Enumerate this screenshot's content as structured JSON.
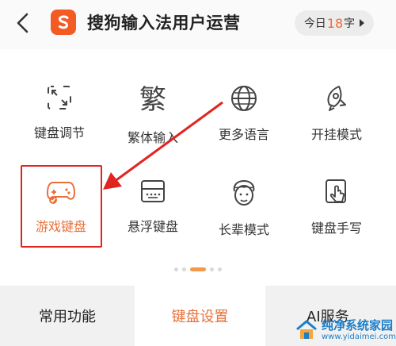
{
  "header": {
    "title": "搜狗输入法用户运营",
    "today_prefix": "今日",
    "today_count": "18",
    "today_suffix": "字",
    "accent": "#f35b24"
  },
  "features": [
    {
      "label": "键盘调节",
      "icon": "resize-icon"
    },
    {
      "label": "繁体输入",
      "icon": "traditional-char-icon",
      "glyph": "繁"
    },
    {
      "label": "更多语言",
      "icon": "globe-icon"
    },
    {
      "label": "开挂模式",
      "icon": "rocket-icon"
    },
    {
      "label": "游戏键盘",
      "icon": "gamepad-icon"
    },
    {
      "label": "悬浮键盘",
      "icon": "floating-keyboard-icon"
    },
    {
      "label": "长辈模式",
      "icon": "elder-face-icon"
    },
    {
      "label": "键盘手写",
      "icon": "handwriting-icon"
    }
  ],
  "pager": {
    "pages": 5,
    "active": 2
  },
  "tabs": [
    {
      "label": "常用功能",
      "active": false
    },
    {
      "label": "键盘设置",
      "active": true
    },
    {
      "label": "AI服务",
      "active": false
    }
  ],
  "watermark": {
    "name": "纯净系统家园",
    "url": "www.yidaimei.com"
  },
  "colors": {
    "highlight": "#e2241f",
    "active_text": "#e9703a"
  }
}
